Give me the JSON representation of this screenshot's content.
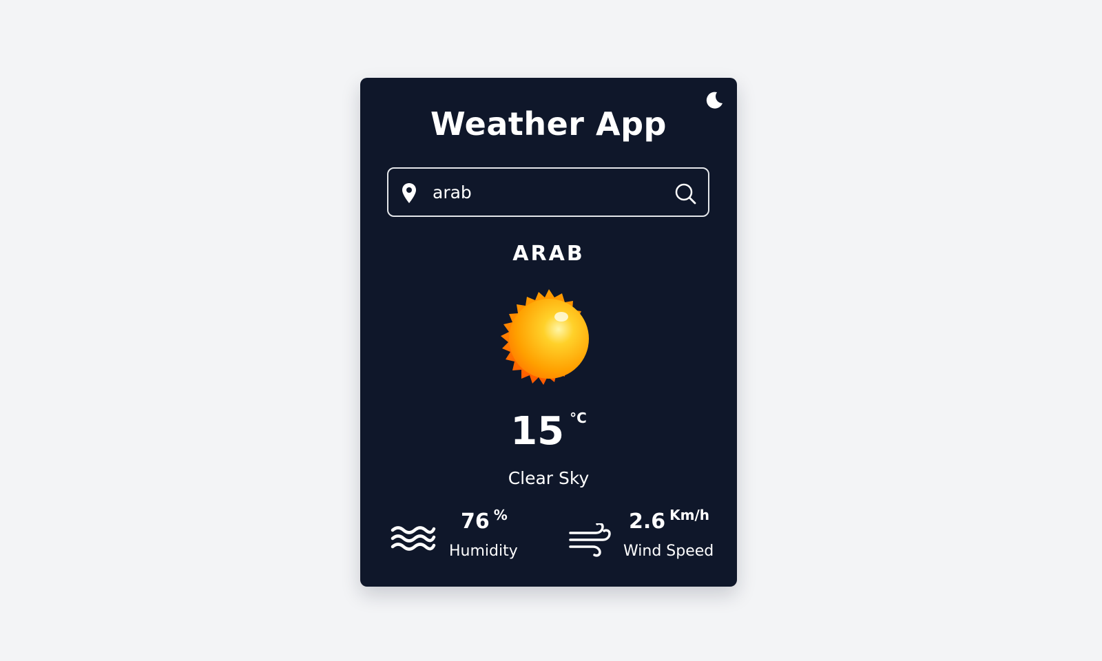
{
  "app": {
    "title": "Weather App",
    "theme_toggle_icon": "moon-icon"
  },
  "search": {
    "value": "arab",
    "location_icon": "location-pin-icon",
    "submit_icon": "search-icon"
  },
  "weather": {
    "city": "ARAB",
    "condition_icon": "sun-icon",
    "temperature": "15",
    "temperature_unit": "°C",
    "description": "Clear Sky"
  },
  "stats": {
    "humidity": {
      "icon": "humidity-waves-icon",
      "value": "76",
      "unit": "%",
      "label": "Humidity"
    },
    "wind": {
      "icon": "wind-icon",
      "value": "2.6",
      "unit": "Km/h",
      "label": "Wind Speed"
    }
  },
  "colors": {
    "page_background": "#f3f4f6",
    "card_background": "#0f172a",
    "text": "#ffffff",
    "sun_core": "#ffb300",
    "sun_rays": "#ff7a00"
  }
}
